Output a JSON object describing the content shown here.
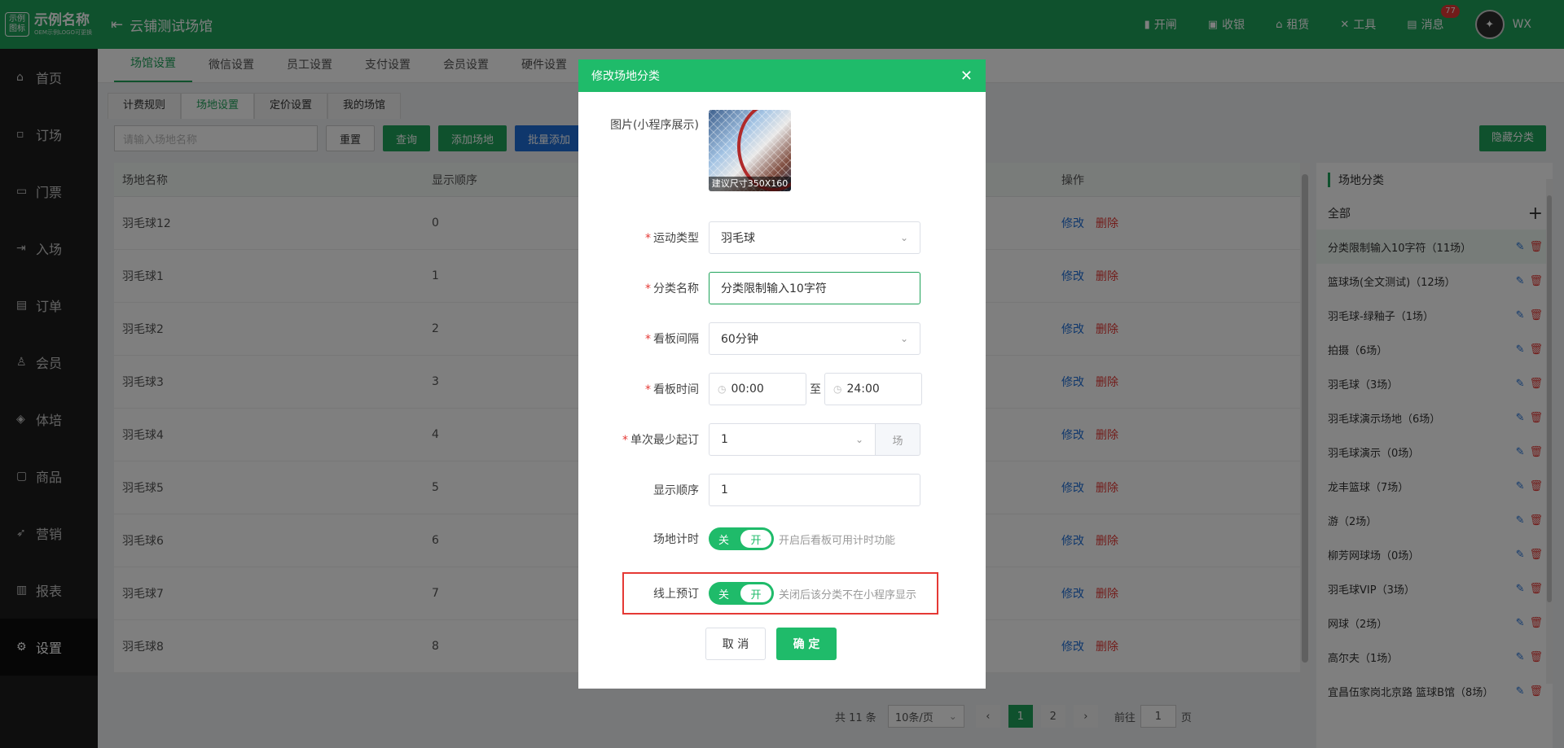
{
  "brand": {
    "logo_mark": "示例\n图标",
    "name": "示例名称",
    "sub": "OEM示例LOGO可更换"
  },
  "header": {
    "venue": "云铺测试场馆",
    "nav": [
      {
        "label": "开闸",
        "icon": "gate-icon"
      },
      {
        "label": "收银",
        "icon": "cashier-icon"
      },
      {
        "label": "租赁",
        "icon": "rent-icon"
      },
      {
        "label": "工具",
        "icon": "tools-icon"
      },
      {
        "label": "消息",
        "icon": "message-icon",
        "badge": "77"
      }
    ],
    "user": "WX"
  },
  "sidebar": {
    "items": [
      {
        "label": "首页",
        "icon": "home-icon"
      },
      {
        "label": "订场",
        "icon": "booking-icon"
      },
      {
        "label": "门票",
        "icon": "ticket-icon"
      },
      {
        "label": "入场",
        "icon": "entry-icon"
      },
      {
        "label": "订单",
        "icon": "order-icon"
      },
      {
        "label": "会员",
        "icon": "member-icon"
      },
      {
        "label": "体培",
        "icon": "training-icon"
      },
      {
        "label": "商品",
        "icon": "goods-icon"
      },
      {
        "label": "营销",
        "icon": "marketing-icon"
      },
      {
        "label": "报表",
        "icon": "report-icon"
      },
      {
        "label": "设置",
        "icon": "settings-icon",
        "active": true
      }
    ]
  },
  "main": {
    "tabs": [
      "场馆设置",
      "微信设置",
      "员工设置",
      "支付设置",
      "会员设置",
      "硬件设置"
    ],
    "subtabs": [
      "计费规则",
      "场地设置",
      "定价设置",
      "我的场馆"
    ],
    "search_placeholder": "请输入场地名称",
    "buttons": {
      "reset": "重置",
      "query": "查询",
      "add": "添加场地",
      "batch_add": "批量添加",
      "hide_category": "隐藏分类"
    },
    "table": {
      "headers": [
        "场地名称",
        "显示顺序",
        "",
        "操作"
      ],
      "rows": [
        {
          "name": "羽毛球12",
          "order": "0"
        },
        {
          "name": "羽毛球1",
          "order": "1"
        },
        {
          "name": "羽毛球2",
          "order": "2"
        },
        {
          "name": "羽毛球3",
          "order": "3"
        },
        {
          "name": "羽毛球4",
          "order": "4"
        },
        {
          "name": "羽毛球5",
          "order": "5"
        },
        {
          "name": "羽毛球6",
          "order": "6"
        },
        {
          "name": "羽毛球7",
          "order": "7"
        },
        {
          "name": "羽毛球8",
          "order": "8"
        }
      ],
      "edit": "修改",
      "delete": "删除"
    },
    "pagination": {
      "total": "共 11 条",
      "page_size": "10条/页",
      "pages": [
        "1",
        "2"
      ],
      "goto": "前往",
      "goto_value": "1",
      "page_unit": "页"
    }
  },
  "categories": {
    "title": "场地分类",
    "all": "全部",
    "items": [
      "分类限制输入10字符（11场）",
      "篮球场(全文测试)（12场）",
      "羽毛球-绿釉子（1场）",
      "拍摄（6场）",
      "羽毛球（3场）",
      "羽毛球演示场地（6场）",
      "羽毛球演示（0场）",
      "龙丰篮球（7场）",
      "游（2场）",
      "柳芳网球场（0场）",
      "羽毛球VIP（3场）",
      "网球（2场）",
      "高尔夫（1场）",
      "宜昌伍家岗北京路 篮球B馆（8场）"
    ]
  },
  "dialog": {
    "title": "修改场地分类",
    "image_label": "图片(小程序展示)",
    "image_tip": "建议尺寸350X160",
    "sport_label": "运动类型",
    "sport_value": "羽毛球",
    "name_label": "分类名称",
    "name_value": "分类限制输入10字符",
    "interval_label": "看板间隔",
    "interval_value": "60分钟",
    "time_label": "看板时间",
    "time_start": "00:00",
    "time_to": "至",
    "time_end": "24:00",
    "min_label": "单次最少起订",
    "min_value": "1",
    "min_unit": "场",
    "order_label": "显示顺序",
    "order_value": "1",
    "timer_label": "场地计时",
    "timer_hint": "开启后看板可用计时功能",
    "online_label": "线上预订",
    "online_hint": "关闭后该分类不在小程序显示",
    "switch_off": "关",
    "switch_on": "开",
    "cancel": "取 消",
    "confirm": "确 定"
  },
  "colors": {
    "primary": "#1fa35a",
    "dialog_header": "#1fbb6a",
    "link": "#1e6fd9",
    "danger": "#e53935"
  }
}
